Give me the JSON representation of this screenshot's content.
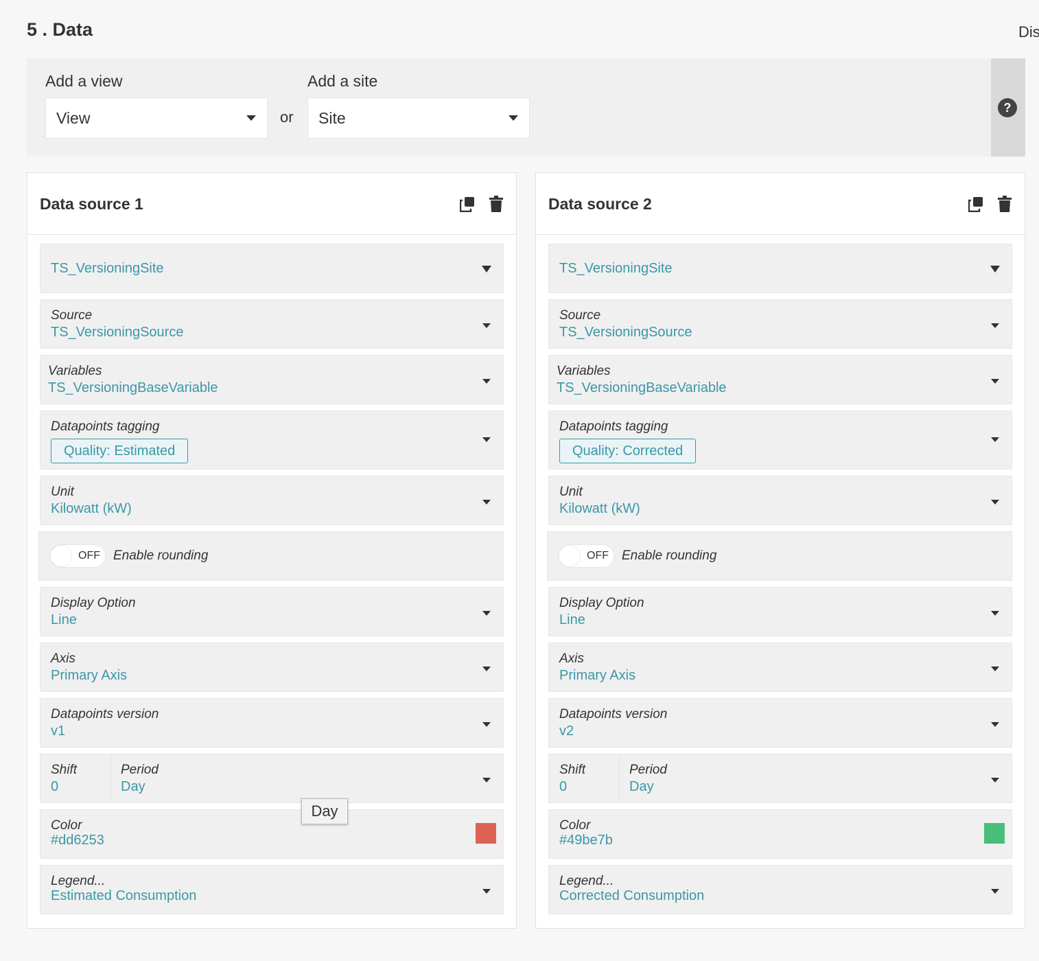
{
  "page": {
    "title": "5 . Data",
    "right_cut_text": "Dis"
  },
  "top": {
    "view_label": "Add a view",
    "view_value": "View",
    "or_text": "or",
    "site_label": "Add a site",
    "site_value": "Site",
    "help_icon": "?"
  },
  "tooltip": "Day",
  "sources": [
    {
      "title": "Data source 1",
      "site": "TS_VersioningSite",
      "source_label": "Source",
      "source_value": "TS_VersioningSource",
      "variables_label": "Variables",
      "variables_value": "TS_VersioningBaseVariable",
      "tagging_label": "Datapoints tagging",
      "tagging_value": "Quality: Estimated",
      "unit_label": "Unit",
      "unit_value": "Kilowatt (kW)",
      "rounding_state": "OFF",
      "rounding_label": "Enable rounding",
      "display_label": "Display Option",
      "display_value": "Line",
      "axis_label": "Axis",
      "axis_value": "Primary Axis",
      "version_label": "Datapoints version",
      "version_value": "v1",
      "shift_label": "Shift",
      "shift_value": "0",
      "period_label": "Period",
      "period_value": "Day",
      "color_label": "Color",
      "color_value": "#dd6253",
      "legend_label": "Legend...",
      "legend_value": "Estimated Consumption"
    },
    {
      "title": "Data source 2",
      "site": "TS_VersioningSite",
      "source_label": "Source",
      "source_value": "TS_VersioningSource",
      "variables_label": "Variables",
      "variables_value": "TS_VersioningBaseVariable",
      "tagging_label": "Datapoints tagging",
      "tagging_value": "Quality: Corrected",
      "unit_label": "Unit",
      "unit_value": "Kilowatt (kW)",
      "rounding_state": "OFF",
      "rounding_label": "Enable rounding",
      "display_label": "Display Option",
      "display_value": "Line",
      "axis_label": "Axis",
      "axis_value": "Primary Axis",
      "version_label": "Datapoints version",
      "version_value": "v2",
      "shift_label": "Shift",
      "shift_value": "0",
      "period_label": "Period",
      "period_value": "Day",
      "color_label": "Color",
      "color_value": "#49be7b",
      "legend_label": "Legend...",
      "legend_value": "Corrected Consumption"
    }
  ],
  "colors": {
    "accent": "#3b97a8",
    "panel": "#f0f0f0"
  },
  "icons": {
    "duplicate": "duplicate-icon",
    "delete": "trash-icon",
    "help": "help-icon"
  }
}
